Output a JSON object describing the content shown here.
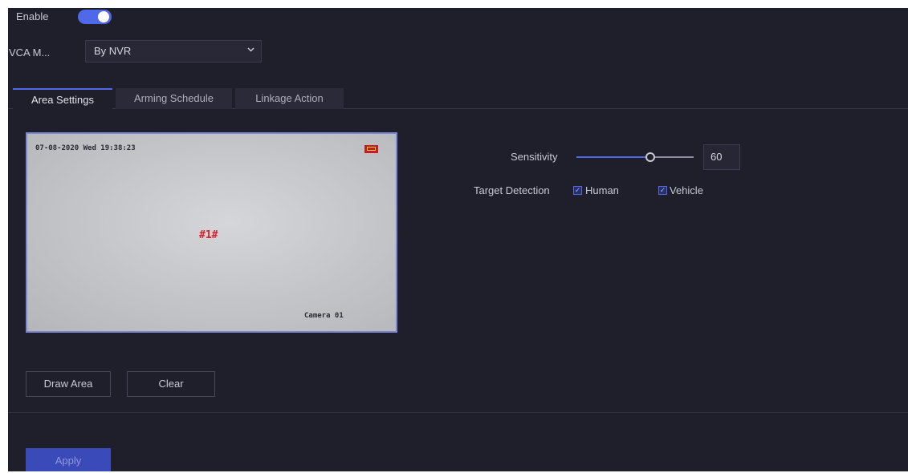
{
  "enable": {
    "label": "Enable",
    "on": true
  },
  "vca_mode": {
    "label": "VCA M...",
    "value": "By NVR"
  },
  "tabs": [
    {
      "label": "Area Settings",
      "active": true
    },
    {
      "label": "Arming Schedule",
      "active": false
    },
    {
      "label": "Linkage Action",
      "active": false
    }
  ],
  "preview": {
    "timestamp": "07-08-2020 Wed 19:38:23",
    "zone_label": "#1#",
    "camera_name": "Camera 01"
  },
  "sensitivity": {
    "label": "Sensitivity",
    "value": "60"
  },
  "target_detection": {
    "label": "Target Detection",
    "options": [
      {
        "label": "Human",
        "checked": true
      },
      {
        "label": "Vehicle",
        "checked": true
      }
    ]
  },
  "buttons": {
    "draw_area": "Draw Area",
    "clear": "Clear",
    "apply": "Apply"
  },
  "colors": {
    "background": "#1f1f2b",
    "accent": "#4f69e8",
    "zone_text": "#d81f2a"
  }
}
